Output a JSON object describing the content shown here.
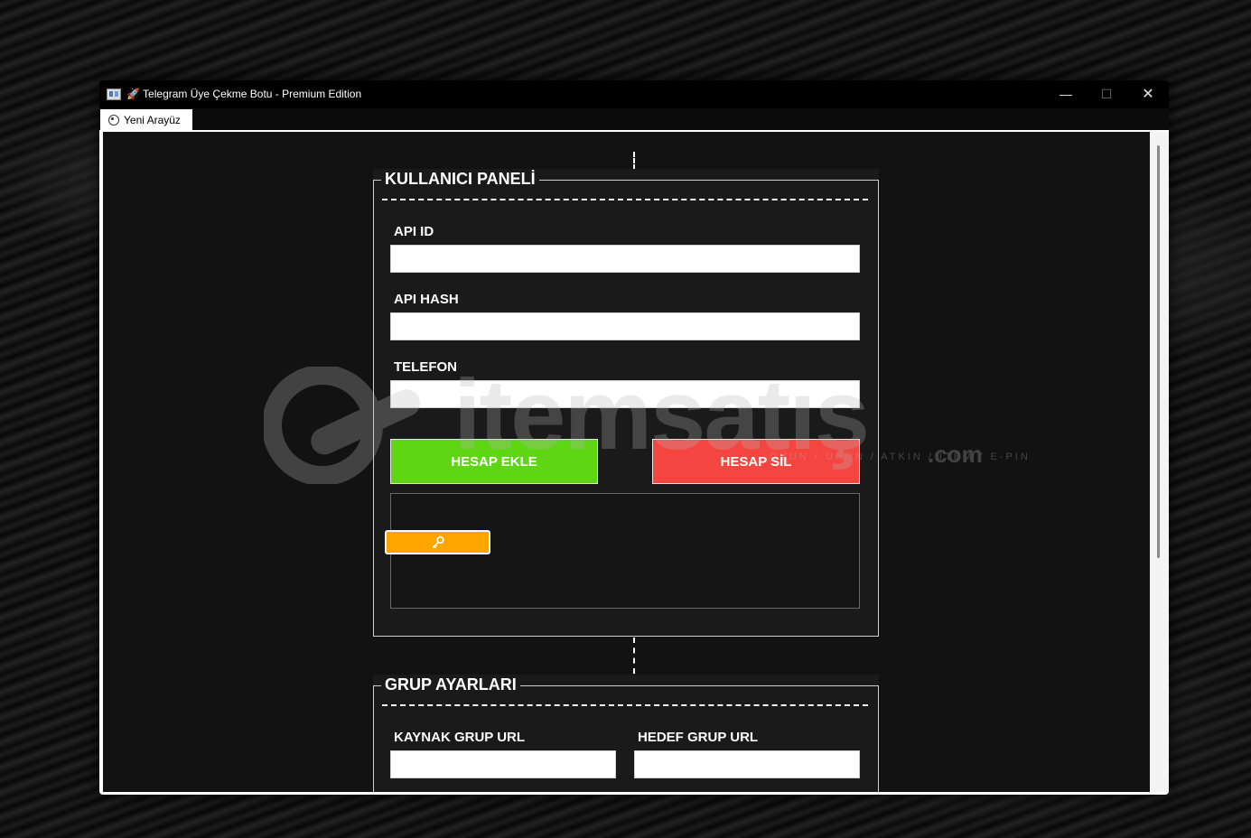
{
  "window": {
    "title": "🚀 Telegram Üye Çekme Botu - Premium Edition",
    "controls": {
      "minimize": "—",
      "maximize": "☐",
      "close": "✕"
    }
  },
  "tabs": [
    {
      "label": "Yeni Arayüz",
      "icon": "palette-icon",
      "active": true
    }
  ],
  "user_panel": {
    "title": "KULLANICI PANELİ",
    "api_id": {
      "label": "API ID",
      "value": ""
    },
    "api_hash": {
      "label": "API HASH",
      "value": ""
    },
    "phone": {
      "label": "TELEFON",
      "value": ""
    },
    "add_button": "HESAP EKLE",
    "delete_button": "HESAP SİL",
    "accounts": [],
    "key_button_icon": "key-icon"
  },
  "group_panel": {
    "title": "GRUP AYARLARI",
    "source": {
      "label": "KAYNAK GRUP URL",
      "value": ""
    },
    "target": {
      "label": "HEDEF GRUP URL",
      "value": ""
    }
  },
  "watermark": {
    "brand": "itemsatış",
    "tagline": "OYUN / ÜRÜN / ATKIN / ITEM / E-PIN",
    "domain": ".com"
  },
  "colors": {
    "add": "#5fd613",
    "delete": "#f54541",
    "key": "#ffa500",
    "panel": "#1a1a1a"
  }
}
